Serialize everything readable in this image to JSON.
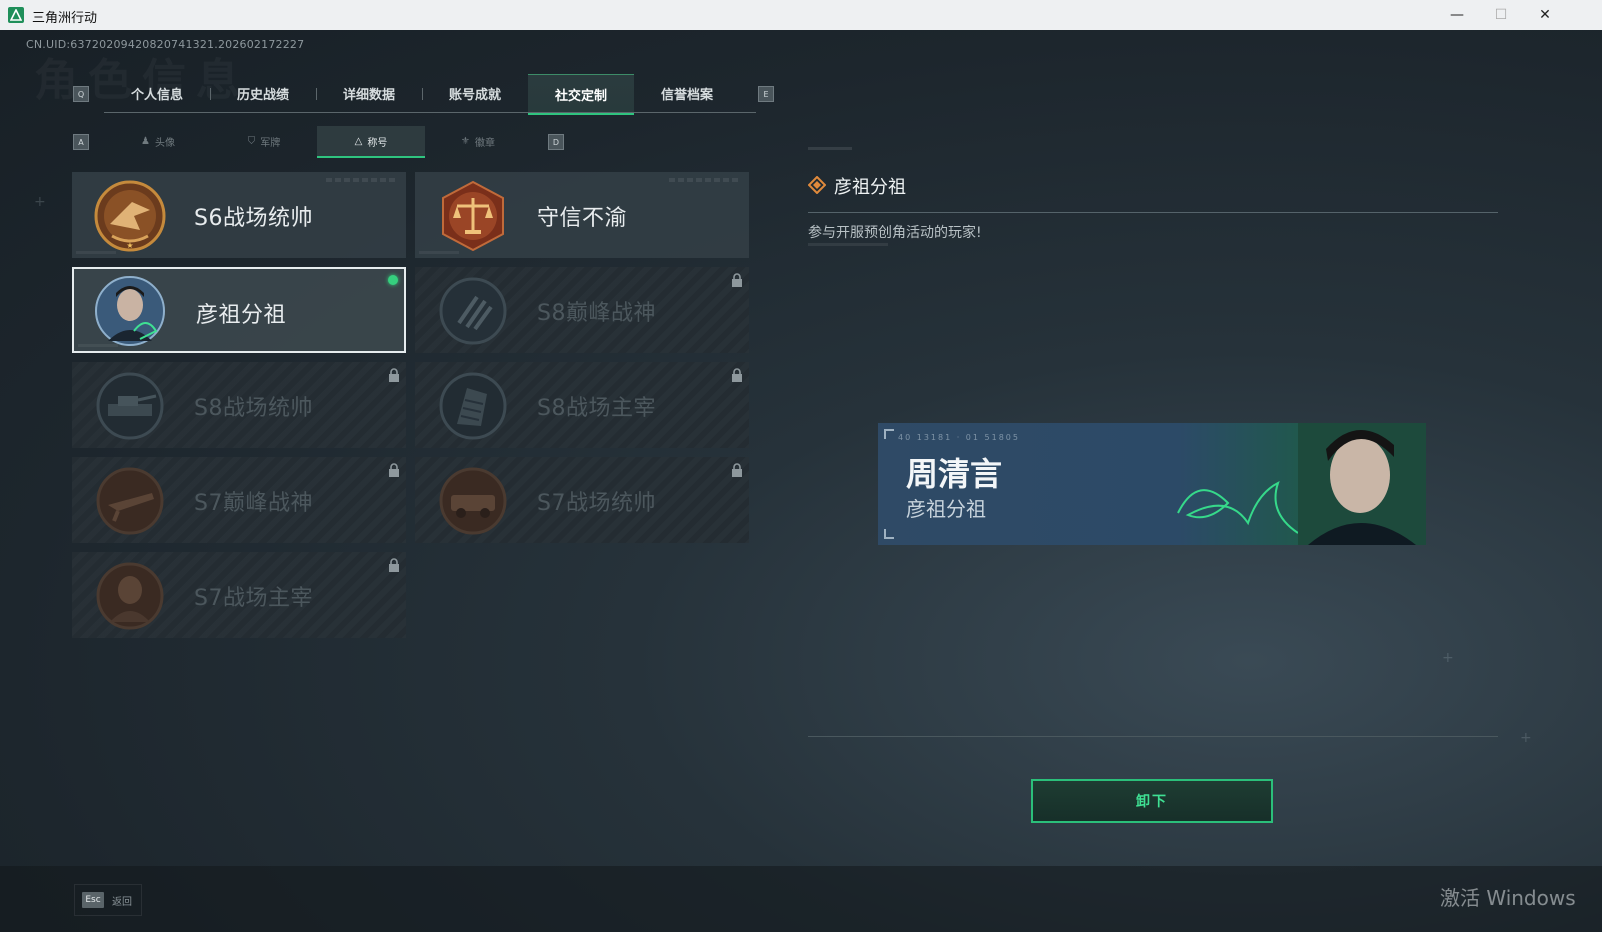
{
  "window": {
    "title": "三角洲行动"
  },
  "uid": "CN.UID:6372020942082074132­1.202602172227",
  "ghost_title": "角色信息",
  "tabs": {
    "left_key": "Q",
    "right_key": "E",
    "items": [
      {
        "label": "个人信息"
      },
      {
        "label": "历史战绩"
      },
      {
        "label": "详细数据"
      },
      {
        "label": "账号成就"
      },
      {
        "label": "社交定制",
        "active": true
      },
      {
        "label": "信誉档案"
      }
    ]
  },
  "subtabs": {
    "left_key": "A",
    "right_key": "D",
    "items": [
      {
        "label": "头像"
      },
      {
        "label": "军牌"
      },
      {
        "label": "称号",
        "active": true
      },
      {
        "label": "徽章"
      }
    ]
  },
  "titles": [
    {
      "label": "S6战场统帅",
      "state": "unlocked"
    },
    {
      "label": "守信不渝",
      "state": "unlocked"
    },
    {
      "label": "彦祖分祖",
      "state": "selected"
    },
    {
      "label": "S8巅峰战神",
      "state": "locked"
    },
    {
      "label": "S8战场统帅",
      "state": "locked"
    },
    {
      "label": "S8战场主宰",
      "state": "locked"
    },
    {
      "label": "S7巅峰战神",
      "state": "locked"
    },
    {
      "label": "S7战场统帅",
      "state": "locked"
    },
    {
      "label": "S7战场主宰",
      "state": "locked"
    }
  ],
  "detail": {
    "title": "彦祖分祖",
    "description": "参与开服预创角活动的玩家!",
    "banner": {
      "code": "40 13181 · 01 51805",
      "player_name": "周清言",
      "title": "彦祖分祖"
    },
    "unequip_label": "卸下"
  },
  "footer": {
    "esc_key": "Esc",
    "esc_label": "返回"
  },
  "watermark": "激活 Windows",
  "colors": {
    "accent": "#2fc47f",
    "panel": "#343f46",
    "banner_blue": "#2f4a66"
  }
}
